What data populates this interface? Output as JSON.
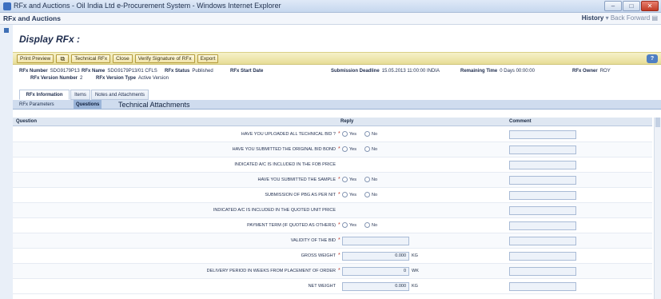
{
  "window": {
    "title": "RFx and Auctions - Oil India Ltd e-Procurement System - Windows Internet Explorer",
    "controls": [
      "–",
      "□",
      "✕"
    ]
  },
  "browser": {
    "tab_label": "RFx and Auctions",
    "nav_history": "History",
    "nav_back": "Back",
    "nav_forward": "Forward"
  },
  "page": {
    "title": "Display RFx :",
    "toolbar": {
      "buttons": [
        "Print Preview",
        "Technical RFx",
        "Close",
        "Verify Signature of RFx",
        "Export"
      ]
    },
    "header": {
      "rfx_number_label": "RFx Number",
      "rfx_number": "SDG9179P13",
      "rfx_name_label": "RFx Name",
      "rfx_name": "SDG9179P13/01 CFLS",
      "rfx_status_label": "RFx Status",
      "rfx_status": "Published",
      "rfx_start_label": "RFx Start Date",
      "submission_label": "Submission Deadline",
      "submission_value": "15.05.2013 11:00:00 INDIA",
      "remaining_label": "Remaining Time",
      "remaining_value": "0 Days 00:00:00",
      "owner_label": "RFx Owner",
      "owner_value": "ROY",
      "version_number_label": "RFx Version Number",
      "version_number": "2",
      "version_type_label": "RFx Version Type",
      "version_type": "Active Version"
    },
    "main_tabs": [
      "RFx Information",
      "Items",
      "Notes and Attachments"
    ],
    "sub_tabs": [
      "RFx Parameters",
      "Questions",
      "Technical Attachments"
    ],
    "table": {
      "col_question": "Question",
      "col_reply": "Reply",
      "col_comment": "Comment",
      "yes_label": "Yes",
      "no_label": "No",
      "rows": [
        {
          "question": "HAVE YOU UPLOADED ALL TECHNICAL BID ?",
          "required": "*"
        },
        {
          "question": "HAVE YOU SUBMITTED THE ORIGINAL BID BOND",
          "required": "*"
        },
        {
          "question": "INDICATED A/C IS INCLUDED IN THE FOB PRICE",
          "required": ""
        },
        {
          "question": "HAVE YOU SUBMITTED THE SAMPLE",
          "required": "*"
        },
        {
          "question": "SUBMISSION OF PBG AS PER NIT",
          "required": "*"
        },
        {
          "question": "INDICATED A/C IS INCLUDED IN THE QUOTED UNIT PRICE",
          "required": ""
        },
        {
          "question": "PAYMENT TERM (IF QUOTED AS OTHERS)",
          "required": "*"
        },
        {
          "question": "VALIDITY OF THE BID",
          "required": "*"
        },
        {
          "question": "GROSS WEIGHT",
          "required": "*",
          "value": "0.000",
          "unit": "KG"
        },
        {
          "question": "DELIVERY PERIOD IN WEEKS FROM PLACEMENT OF ORDER",
          "required": "*",
          "value": "0",
          "unit": "WK"
        },
        {
          "question": "NET WEIGHT",
          "required": "",
          "value": "0.000",
          "unit": "KG"
        }
      ]
    }
  }
}
